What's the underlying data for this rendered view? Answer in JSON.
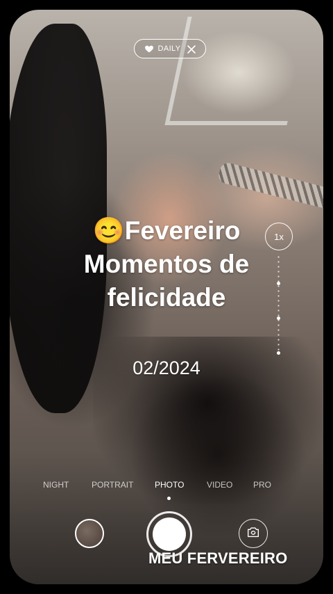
{
  "badge": {
    "label": "DAILY",
    "icon_left": "heart-icon",
    "icon_right": "close-icon"
  },
  "zoom": {
    "label": "1x"
  },
  "headline": {
    "emoji": "😊",
    "line1": "Fevereiro",
    "line2": "Momentos de",
    "line3": "felicidade"
  },
  "date": "02/2024",
  "camera_modes": {
    "items": [
      "NIGHT",
      "PORTRAIT",
      "PHOTO",
      "VIDEO",
      "PRO"
    ],
    "selected": "PHOTO"
  },
  "controls": {
    "gallery": "gallery-thumbnail",
    "shutter": "shutter-button",
    "switch": "switch-camera-icon"
  },
  "caption": "MEU FERVEREIRO"
}
